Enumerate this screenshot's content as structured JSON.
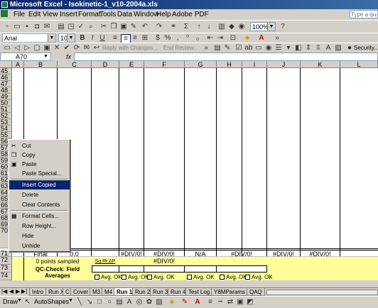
{
  "window": {
    "title": "Microsoft Excel - Isokinetic-1_v10-2004a.xls"
  },
  "menu": [
    "File",
    "Edit",
    "View",
    "Insert",
    "Format",
    "Tools",
    "Data",
    "Window",
    "Help",
    "Adobe PDF"
  ],
  "help_box": {
    "placeholder": "Type a que"
  },
  "toolbar": {
    "zoom": "100%"
  },
  "format_toolbar": {
    "font": "Arial",
    "size": "10"
  },
  "reviewing_toolbar": {
    "reply_label": "Reply with Changes...",
    "end_review_label": "End Review...",
    "security_label": "Security..."
  },
  "name_box": {
    "value": "A70",
    "fx": "fx"
  },
  "columns": [
    "A",
    "B",
    "C",
    "D",
    "E",
    "F",
    "G",
    "H",
    "I",
    "J",
    "K",
    "L"
  ],
  "rows": [
    "45",
    "46",
    "47",
    "48",
    "49",
    "50",
    "51",
    "52",
    "53",
    "54",
    "55",
    "56",
    "57",
    "58",
    "59",
    "60",
    "61",
    "62",
    "63",
    "64",
    "65",
    "66",
    "67",
    "68",
    "69",
    "70",
    "71",
    "72",
    "73",
    "74"
  ],
  "row71": {
    "label": "Final",
    "c": "0.0",
    "e": "#DIV/0!",
    "f": "#DIV/0!",
    "g": "N/A",
    "h": "#DIV/0!",
    "j": "#DIV/0!",
    "k": "#DIV/0!"
  },
  "row72": {
    "points": "0 points sampled",
    "sqrt": "Sq.Rt.ΔP",
    "f": "#DIV/0!"
  },
  "row73": {
    "qc": "QC-Check: Field Averages"
  },
  "row74": {
    "avg_ok": "Avg. OK"
  },
  "context_menu": {
    "items": [
      {
        "label": "Cut",
        "icon": "scissors-icon"
      },
      {
        "label": "Copy",
        "icon": "copy-icon"
      },
      {
        "label": "Paste",
        "icon": "paste-icon"
      },
      {
        "label": "Paste Special...",
        "icon": ""
      },
      {
        "label": "Insert Copied Cells",
        "icon": ""
      },
      {
        "label": "Delete",
        "icon": ""
      },
      {
        "label": "Clear Contents",
        "icon": ""
      },
      {
        "label": "Format Cells...",
        "icon": "format-cells-icon"
      },
      {
        "label": "Row Height...",
        "icon": ""
      },
      {
        "label": "Hide",
        "icon": ""
      },
      {
        "label": "Unhide",
        "icon": ""
      }
    ]
  },
  "sheet_tabs": [
    "Intro",
    "Run X",
    "C",
    "Cover",
    "M3",
    "M4",
    "Run 1",
    "Run 2",
    "Run 3",
    "Run 4",
    "Test Log",
    "Y8MParams",
    "QAQ"
  ],
  "active_tab": "Run 1",
  "drawbar": {
    "draw": "Draw",
    "autoshapes": "AutoShapes"
  }
}
